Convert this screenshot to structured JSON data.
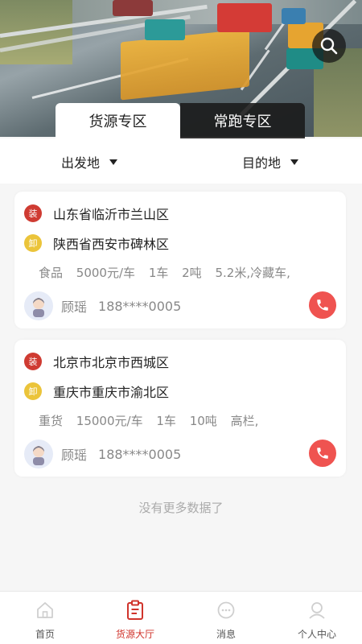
{
  "header": {
    "search_icon": "search-icon"
  },
  "tabs": {
    "active_label": "货源专区",
    "inactive_label": "常跑专区"
  },
  "filters": {
    "origin_label": "出发地",
    "destination_label": "目的地"
  },
  "listings": [
    {
      "load_badge": "装",
      "origin": "山东省临沂市兰山区",
      "unload_badge": "卸",
      "destination": "陕西省西安市碑林区",
      "cargo": "食品",
      "price": "5000元/车",
      "trucks": "1车",
      "weight": "2吨",
      "vehicle": "5.2米,冷藏车,",
      "contact_name": "顾瑶",
      "contact_phone": "188****0005"
    },
    {
      "load_badge": "装",
      "origin": "北京市北京市西城区",
      "unload_badge": "卸",
      "destination": "重庆市重庆市渝北区",
      "cargo": "重货",
      "price": "15000元/车",
      "trucks": "1车",
      "weight": "10吨",
      "vehicle": "高栏,",
      "contact_name": "顾瑶",
      "contact_phone": "188****0005"
    }
  ],
  "footer_message": "没有更多数据了",
  "bottom_nav": {
    "items": [
      {
        "label": "首页",
        "icon": "home-icon"
      },
      {
        "label": "货源大厅",
        "icon": "clipboard-icon"
      },
      {
        "label": "消息",
        "icon": "message-icon"
      },
      {
        "label": "个人中心",
        "icon": "user-icon"
      }
    ],
    "active_color": "#d0342c",
    "inactive_color": "#555555"
  },
  "colors": {
    "load_badge": "#cf3b32",
    "unload_badge": "#ebc43a",
    "call_button": "#ef5350"
  }
}
